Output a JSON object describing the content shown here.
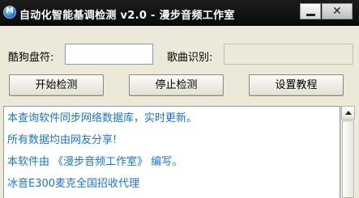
{
  "window": {
    "title": "自动化智能基调检测 v2.0 - 漫步音频工作室",
    "close_glyph": "✕"
  },
  "form": {
    "drive_label": "酷狗盘符:",
    "drive_value": "",
    "recognition_label": "歌曲识别:",
    "recognition_value": ""
  },
  "buttons": {
    "start": "开始检测",
    "stop": "停止检测",
    "settings": "设置教程"
  },
  "log": {
    "lines": [
      "本查询软件同步网络数据库，实时更新。",
      "所有数据均由网友分享!",
      "本软件由 《漫步音频工作室》 编写。",
      "冰音E300麦克全国招收代理"
    ],
    "text_color": "#1873d6"
  }
}
